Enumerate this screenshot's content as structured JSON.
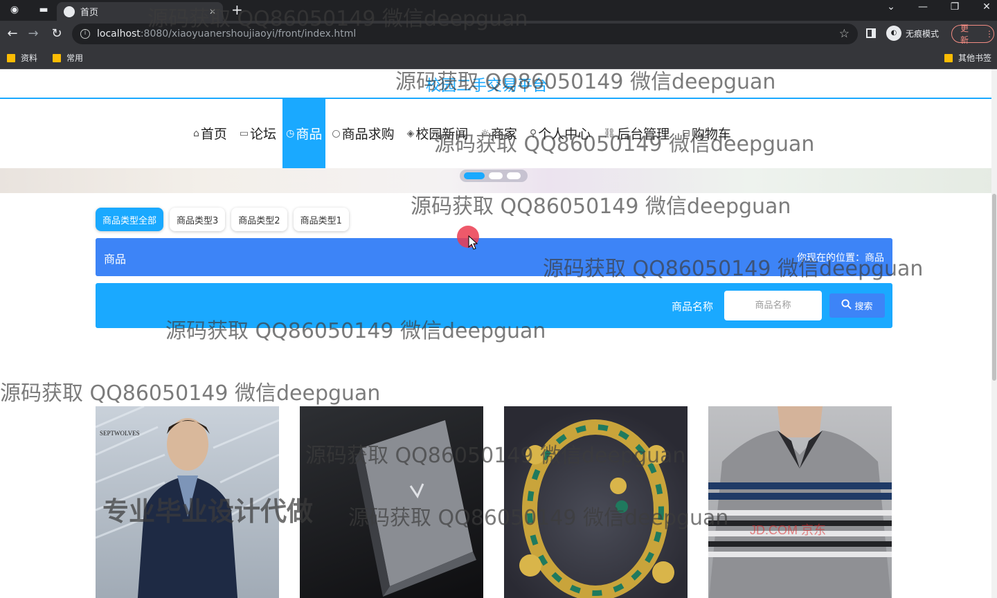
{
  "browser": {
    "tab_title": "首页",
    "url_host": "localhost",
    "url_rest": ":8080/xiaoyuanershoujiaoyi/front/index.html",
    "incognito_label": "无痕模式",
    "update_label": "更新",
    "bookmarks": [
      "资料",
      "常用"
    ],
    "other_bookmarks": "其他书签"
  },
  "site": {
    "title": "校园二手交易平台"
  },
  "nav": [
    {
      "icon": "⌂",
      "label": "首页"
    },
    {
      "icon": "▭",
      "label": "论坛"
    },
    {
      "icon": "◷",
      "label": "商品"
    },
    {
      "icon": "○",
      "label": "商品求购"
    },
    {
      "icon": "◈",
      "label": "校园新闻"
    },
    {
      "icon": "☼",
      "label": "商家"
    },
    {
      "icon": "⚲",
      "label": "个人中心"
    },
    {
      "icon": "⛓",
      "label": "后台管理"
    },
    {
      "icon": "⊟",
      "label": "购物车"
    }
  ],
  "category_chips": [
    "商品类型全部",
    "商品类型3",
    "商品类型2",
    "商品类型1"
  ],
  "breadcrumb": {
    "section": "商品",
    "location": "你现在的位置：商品"
  },
  "search": {
    "label": "商品名称",
    "placeholder": "商品名称",
    "button": "搜索"
  },
  "products": [
    {
      "image": "man-jacket"
    },
    {
      "image": "laptop"
    },
    {
      "image": "gold-necklace"
    },
    {
      "image": "striped-polo"
    }
  ],
  "card1_brand_text": "SEPTWOLVES",
  "card4_overlay_text": "JD.COM 京东",
  "watermarks": [
    "源码获取 QQ86050149 微信deepguan",
    "源码获取 QQ86050149 微信deepguan",
    "源码获取 QQ86050149 微信deepguan",
    "源码获取 QQ86050149 微信deepguan",
    "源码获取 QQ86050149 微信deepguan",
    "源码获取 QQ86050149 微信deepguan",
    "源码获取 QQ86050149 微信deepguan",
    "源码获取 QQ86050149 微信deepguan",
    "源码获取 QQ86050149 微信deepguan"
  ],
  "promo_watermark": "专业毕业设计代做",
  "colors": {
    "primary": "#1aa9ff",
    "bar_blue": "#3d84f7"
  }
}
